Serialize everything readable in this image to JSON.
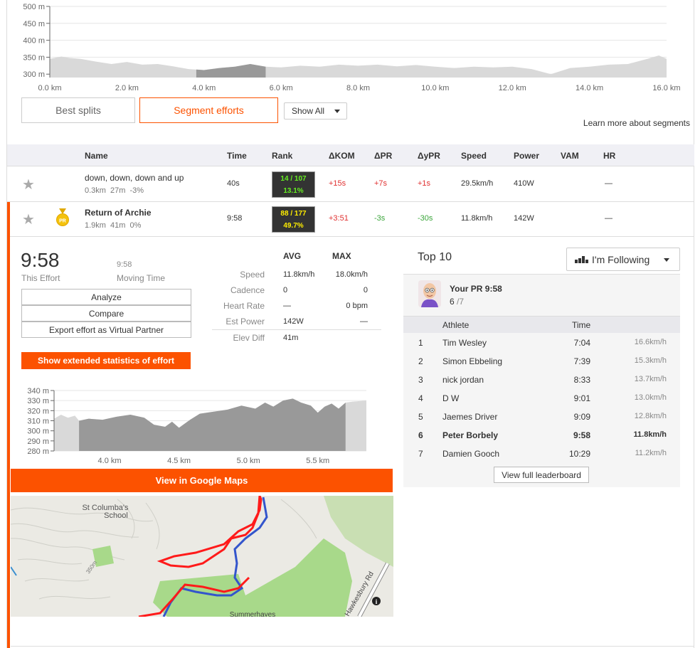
{
  "elevation_chart": {
    "chart_data": {
      "type": "area",
      "title": "",
      "xlabel": "",
      "ylabel": "",
      "y_ticks": [
        "500 m",
        "450 m",
        "400 m",
        "350 m",
        "300 m"
      ],
      "x_ticks": [
        "0.0 km",
        "2.0 km",
        "4.0 km",
        "6.0 km",
        "8.0 km",
        "10.0 km",
        "12.0 km",
        "14.0 km",
        "16.0 km"
      ],
      "xlim": [
        0,
        16
      ],
      "ylim": [
        290,
        500
      ],
      "highlight_range_km": [
        3.8,
        5.6
      ],
      "x": [
        0,
        0.3,
        0.5,
        0.8,
        1.2,
        1.6,
        2.0,
        2.4,
        2.8,
        3.2,
        3.6,
        4.0,
        4.4,
        4.8,
        5.2,
        5.6,
        6.0,
        6.5,
        7.0,
        7.5,
        8.0,
        8.5,
        9.0,
        9.5,
        10.0,
        10.5,
        11.0,
        11.5,
        12.0,
        12.5,
        13.0,
        13.5,
        14.0,
        14.5,
        15.0,
        15.5,
        15.8,
        16.0
      ],
      "y": [
        345,
        352,
        348,
        345,
        337,
        330,
        336,
        328,
        330,
        323,
        315,
        312,
        318,
        322,
        330,
        322,
        320,
        325,
        322,
        328,
        325,
        328,
        323,
        327,
        322,
        318,
        322,
        320,
        322,
        315,
        300,
        318,
        322,
        328,
        330,
        345,
        355,
        345
      ]
    }
  },
  "tabs": {
    "best_splits": "Best splits",
    "segment_efforts": "Segment efforts",
    "show_all": "Show All",
    "learn_more": "Learn more about segments"
  },
  "table": {
    "headers": [
      "Name",
      "Time",
      "Rank",
      "ΔKOM",
      "ΔPR",
      "ΔyPR",
      "Speed",
      "Power",
      "VAM",
      "HR"
    ],
    "rows": [
      {
        "name": "down, down, down and up",
        "distance": "0.3km",
        "elev": "27m",
        "grade": "-3%",
        "time": "40s",
        "rank": "14 / 107",
        "rank_pct": "13.1%",
        "dkom": "+15s",
        "dpr": "+7s",
        "dypr": "+1s",
        "speed": "29.5km/h",
        "power": "410W",
        "vam": "",
        "hr": "—"
      },
      {
        "name": "Return of Archie",
        "distance": "1.9km",
        "elev": "41m",
        "grade": "0%",
        "time": "9:58",
        "rank": "88 / 177",
        "rank_pct": "49.7%",
        "dkom": "+3:51",
        "dpr": "-3s",
        "dypr": "-30s",
        "speed": "11.8km/h",
        "power": "142W",
        "vam": "",
        "hr": "—",
        "badge": "PR"
      }
    ]
  },
  "effort": {
    "time": "9:58",
    "this_effort": "This Effort",
    "moving_time_value": "9:58",
    "moving_time_label": "Moving Time",
    "buttons": {
      "analyze": "Analyze",
      "compare": "Compare",
      "export": "Export effort as Virtual Partner",
      "extended": "Show extended statistics of effort"
    },
    "stats": {
      "avg_label": "AVG",
      "max_label": "MAX",
      "rows": [
        {
          "label": "Speed",
          "avg": "11.8km/h",
          "max": "18.0km/h"
        },
        {
          "label": "Cadence",
          "avg": "0",
          "max": "0"
        },
        {
          "label": "Heart Rate",
          "avg": "—",
          "max": "0 bpm"
        },
        {
          "label": "Est Power",
          "avg": "142W",
          "max": "—"
        },
        {
          "label": "Elev Diff",
          "avg": "41m",
          "max": ""
        }
      ]
    }
  },
  "segment_chart": {
    "chart_data": {
      "type": "area",
      "title": "",
      "xlabel": "",
      "ylabel": "",
      "y_ticks": [
        "340 m",
        "330 m",
        "320 m",
        "310 m",
        "300 m",
        "290 m",
        "280 m"
      ],
      "x_ticks": [
        "4.0 km",
        "4.5 km",
        "5.0 km",
        "5.5 km"
      ],
      "xlim": [
        3.6,
        5.85
      ],
      "ylim": [
        280,
        340
      ],
      "highlight_range_km": [
        3.78,
        5.7
      ],
      "x": [
        3.6,
        3.65,
        3.7,
        3.75,
        3.78,
        3.85,
        3.95,
        4.05,
        4.15,
        4.25,
        4.32,
        4.4,
        4.45,
        4.5,
        4.58,
        4.65,
        4.75,
        4.85,
        4.95,
        5.05,
        5.12,
        5.18,
        5.25,
        5.32,
        5.38,
        5.45,
        5.5,
        5.55,
        5.6,
        5.65,
        5.7,
        5.75,
        5.85
      ],
      "y": [
        312,
        316,
        313,
        315,
        310,
        312,
        311,
        314,
        316,
        313,
        306,
        304,
        309,
        303,
        311,
        317,
        319,
        321,
        325,
        322,
        328,
        324,
        330,
        332,
        328,
        325,
        318,
        324,
        327,
        322,
        328,
        329,
        330
      ]
    }
  },
  "maps_button": "View in Google Maps",
  "map": {
    "labels": [
      "St Columba's",
      "School",
      "Summerhayes",
      "350m",
      "Hawkesbury Rd",
      "i"
    ]
  },
  "top10": {
    "title": "Top 10",
    "filter": "I'm Following",
    "your_pr": "Your PR 9:58",
    "your_rank": "6",
    "your_rank_of": "/7",
    "headers": {
      "athlete": "Athlete",
      "time": "Time"
    },
    "rows": [
      {
        "rank": "1",
        "name": "Tim Wesley",
        "time": "7:04",
        "speed": "16.6km/h"
      },
      {
        "rank": "2",
        "name": "Simon Ebbeling",
        "time": "7:39",
        "speed": "15.3km/h"
      },
      {
        "rank": "3",
        "name": "nick jordan",
        "time": "8:33",
        "speed": "13.7km/h"
      },
      {
        "rank": "4",
        "name": "D W",
        "time": "9:01",
        "speed": "13.0km/h"
      },
      {
        "rank": "5",
        "name": "Jaemes Driver",
        "time": "9:09",
        "speed": "12.8km/h"
      },
      {
        "rank": "6",
        "name": "Peter Borbely",
        "time": "9:58",
        "speed": "11.8km/h"
      },
      {
        "rank": "7",
        "name": "Damien Gooch",
        "time": "10:29",
        "speed": "11.2km/h"
      }
    ],
    "full_button": "View full leaderboard"
  },
  "colors": {
    "accent": "#fc5200",
    "rank_green": "#66ee22",
    "rank_yellow": "#ffee00",
    "chart_fill": "#d9d9d9",
    "chart_highlight": "#999999"
  }
}
